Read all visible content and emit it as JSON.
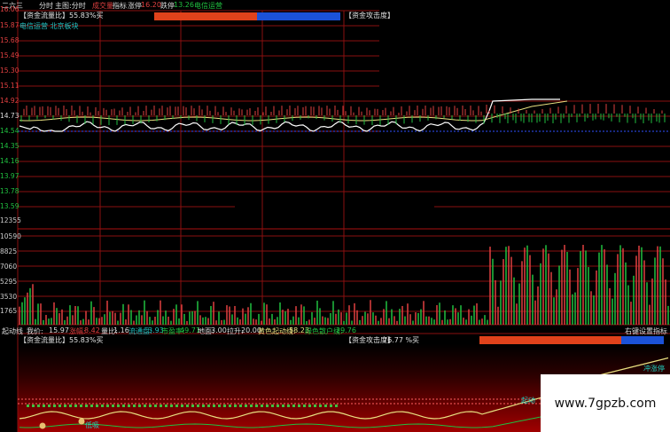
{
  "header": {
    "stock_code": "二六三",
    "mode": "分时",
    "main_chart": "主图:分时",
    "volume_label": "成交量",
    "indicator_label": "指标",
    "limit_up_label": "涨停",
    "limit_up_value": "16.20",
    "limit_down_label": "跌停",
    "limit_down_value": "13.26",
    "sector": "电信运营"
  },
  "top_panel": {
    "capital_label": "【资金流量比】55.83%买",
    "sector_tags": "电信运营 北京板块",
    "attack_label": "【资金攻击度】",
    "attack_value": "76.77 %买"
  },
  "y_axis_price": [
    "16.06",
    "15.87",
    "15.68",
    "15.49",
    "15.30",
    "15.11",
    "14.92",
    "14.73",
    "14.54",
    "14.35",
    "14.16",
    "13.97",
    "13.78",
    "13.59"
  ],
  "y_axis_volume": [
    "12355",
    "10590",
    "8825",
    "7060",
    "5295",
    "3530",
    "1765"
  ],
  "status_bar": {
    "start_line": "起动线",
    "my_price_label": "我价:",
    "my_price": "15.97",
    "change_label": "涨幅:",
    "change_value": "8.42",
    "volume_ratio_label": "量比:",
    "volume_ratio": "1.16",
    "float_label": "流通盘:",
    "float_value": "3.93",
    "pe_label": "市盈率:",
    "pe_value": "49.71",
    "ground_label": "地面:",
    "ground_value": "3.00",
    "pull_label": "拉升:",
    "pull_value": "20.00",
    "yellow_label": "黄色起动线:",
    "yellow_value": "58.23",
    "green_label": "绿色散户线:",
    "green_value": "29.76",
    "settings_button": "右键设置指标"
  },
  "bottom_panel": {
    "capital_label": "【资金流量比】55.83%买",
    "attack_label": "【资金攻击度】",
    "attack_value": "76.77 %买",
    "marker_limit_up": "冲涨停",
    "marker_start": "起动",
    "marker_main": "主力",
    "marker_low": "低吸"
  },
  "gauges": {
    "top_buy_fraction": 0.55,
    "bottom_buy_fraction": 0.77
  },
  "colors": {
    "price_line": "#ffffff",
    "avg_line": "#e8e080",
    "up": "#e04040",
    "down": "#20c040",
    "grid": "#8a1010"
  },
  "watermark": "www.7gpzb.com"
}
